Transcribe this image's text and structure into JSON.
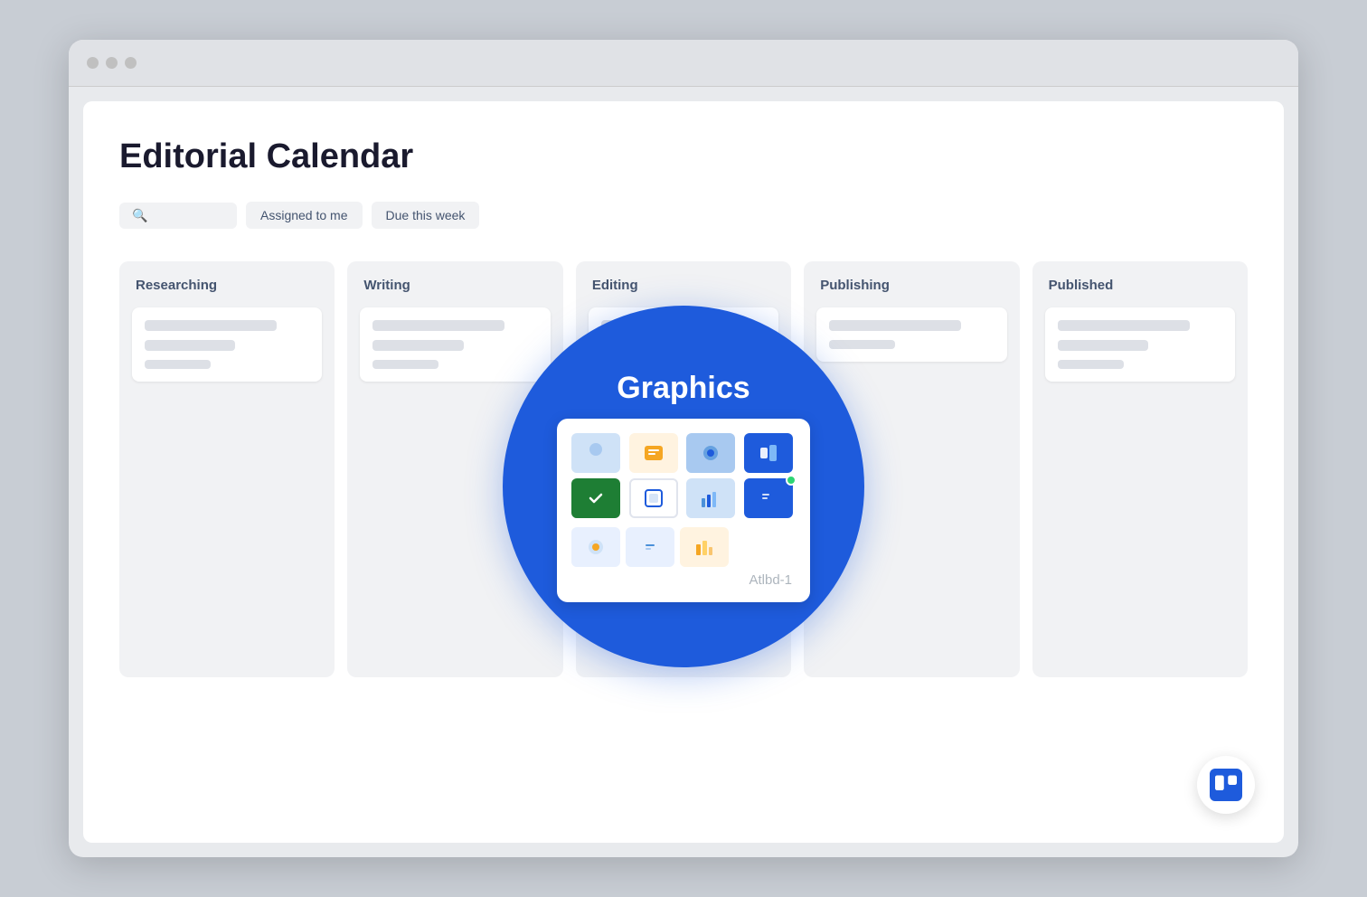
{
  "page": {
    "title": "Editorial Calendar"
  },
  "toolbar": {
    "search_placeholder": "",
    "filter1": "Assigned to me",
    "filter2": "Due this week"
  },
  "columns": [
    {
      "id": "researching",
      "label": "Researching"
    },
    {
      "id": "writing",
      "label": "Writing"
    },
    {
      "id": "editing",
      "label": "Editing"
    },
    {
      "id": "publishing",
      "label": "Publishing"
    },
    {
      "id": "published",
      "label": "Published"
    }
  ],
  "graphics_card": {
    "title": "Graphics",
    "id_label": "Atlbd-1"
  },
  "icons": {
    "search": "🔍",
    "trello_brand": "T"
  }
}
